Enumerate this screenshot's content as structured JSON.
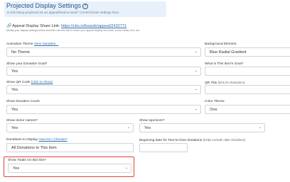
{
  "header": {
    "title": "Projected Display Settings",
    "subtitle": "Is this being projected as an appeal/fund-a-need? Control those settings here."
  },
  "share": {
    "label": "Appeal Display Share Link:",
    "url": "https://cbo.io/boards/appeal/2432771",
    "note": "Modify your display settings below and then use this link to share your appeal display via email, social media, text, etc."
  },
  "fields": {
    "animation_theme": {
      "label": "Animation Theme",
      "link": "View Samples...",
      "value": "No Theme"
    },
    "background_element": {
      "label": "Background Element",
      "value": "Blue Radial Gradient"
    },
    "show_donation_goal": {
      "label": "Show your Donation Goal?",
      "value": "Yes"
    },
    "items_goal": {
      "label": "What is This Item's Goal?",
      "value": ""
    },
    "show_qr_code": {
      "label": "Show QR Code",
      "link": "(click to show)",
      "value": "Yes"
    },
    "qr_title": {
      "label": "QR Title",
      "hint": "(limit 20 characters)",
      "value": ""
    },
    "show_donation_count": {
      "label": "Show Donation Count",
      "value": "Yes"
    },
    "color_theme": {
      "label": "Color Theme",
      "value": "One"
    },
    "show_donor_names": {
      "label": "Show donor names?",
      "value": "Yes"
    },
    "show_sponsors": {
      "label": "Show sponsors?",
      "value": "Yes"
    },
    "donations_to_display": {
      "label": "Donations to Display",
      "link": "How Do I Choose?",
      "value": "All Donations to This Item"
    },
    "beginning_date": {
      "label": "Beginning date for Text-to-Give donations",
      "hint": "(helps exclude older donations)",
      "value": ""
    },
    "show_totals_on_bid_site": {
      "label": "Show Totals On Bid Site?",
      "value": "Yes"
    }
  },
  "colors": {
    "highlight": "#e0413b",
    "link": "#2b6cb0",
    "banner_bg": "#e8f1fb"
  },
  "icons": {
    "info": "info-circle-icon",
    "link": "link-icon",
    "caret": "chevron-down-icon"
  }
}
